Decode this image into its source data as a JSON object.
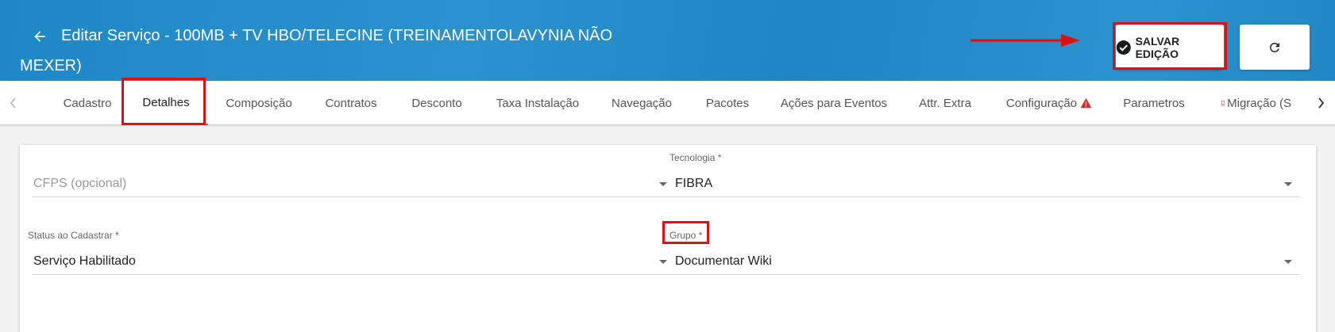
{
  "header": {
    "title": "Editar Serviço - 100MB + TV HBO/TELECINE (TREINAMENTOLAVYNIA NÃO MEXER)",
    "save_label": "SALVAR EDIÇÃO",
    "accent_color": "#1e88c7"
  },
  "icons": {
    "back": "arrow-left-icon",
    "save": "check-circle-icon",
    "refresh": "refresh-icon",
    "warning": "warning-icon",
    "mobile": "mobile-phone-icon"
  },
  "tabs": [
    {
      "label": "Cadastro"
    },
    {
      "label": "Detalhes",
      "active": true
    },
    {
      "label": "Composição"
    },
    {
      "label": "Contratos"
    },
    {
      "label": "Desconto"
    },
    {
      "label": "Taxa Instalação"
    },
    {
      "label": "Navegação"
    },
    {
      "label": "Pacotes"
    },
    {
      "label": "Ações para Eventos"
    },
    {
      "label": "Attr. Extra"
    },
    {
      "label": "Configuração"
    },
    {
      "label": "Parametros"
    },
    {
      "label": "Migração (S"
    }
  ],
  "form": {
    "cfps": {
      "label": "",
      "value": "",
      "placeholder": "CFPS (opcional)"
    },
    "tecnologia": {
      "label": "Tecnologia *",
      "value": "FIBRA"
    },
    "status": {
      "label": "Status ao Cadastrar *",
      "value": "Serviço Habilitado"
    },
    "grupo": {
      "label": "Grupo *",
      "value": "Documentar Wiki"
    }
  }
}
